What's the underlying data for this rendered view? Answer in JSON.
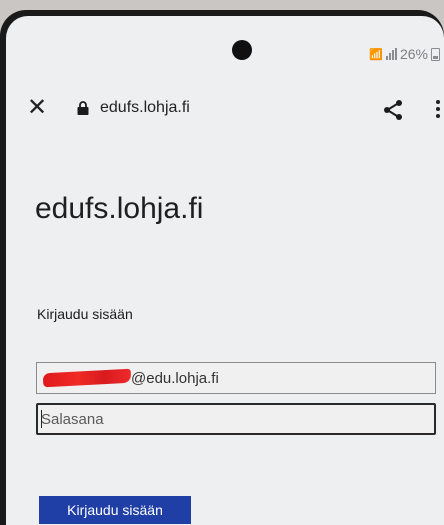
{
  "status_bar": {
    "battery_percent": "26%"
  },
  "browser": {
    "url": "edufs.lohja.fi",
    "close_icon": "close-icon",
    "lock_icon": "lock-icon",
    "share_icon": "share-icon",
    "menu_icon": "more-vert-icon"
  },
  "page": {
    "site_title": "edufs.lohja.fi",
    "signin_heading": "Kirjaudu sisään",
    "email_suffix": "@edu.lohja.fi",
    "password_placeholder": "Salasana",
    "submit_label": "Kirjaudu sisään"
  },
  "colors": {
    "accent": "#1f3fa6",
    "redaction": "#e0191e"
  }
}
